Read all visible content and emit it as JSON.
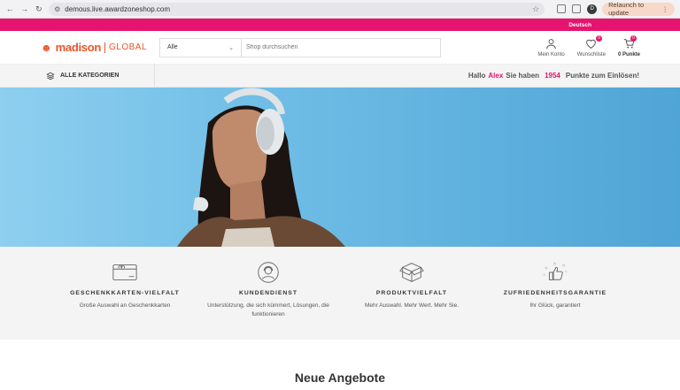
{
  "browser": {
    "url": "demous.live.awardzoneshop.com",
    "relaunch_label": "Relaunch to update",
    "profile_initial": "D"
  },
  "language": "Deutsch",
  "logo": {
    "brand": "madison",
    "global": "GLOBAL"
  },
  "search": {
    "category": "Alle",
    "placeholder": "Shop durchsuchen"
  },
  "header": {
    "account_label": "Mein Konto",
    "wishlist_label": "Wunschliste",
    "wishlist_count": "0",
    "cart_label": "0 Punkte",
    "cart_count": "0"
  },
  "categories": {
    "all_label": "ALLE KATEGORIEN"
  },
  "greeting": {
    "hello": "Hallo",
    "name": "Alex",
    "have": "Sie haben",
    "points": "1954",
    "rest": "Punkte zum Einlösen!"
  },
  "features": [
    {
      "title": "GESCHENKKARTEN-VIELFALT",
      "desc": "Große Auswahl an Geschenkkarten"
    },
    {
      "title": "KUNDENDIENST",
      "desc": "Unterstützung, die sich kümmert, Lösungen, die funktionieren"
    },
    {
      "title": "PRODUKTVIELFALT",
      "desc": "Mehr Auswahl. Mehr Wert. Mehr Sie."
    },
    {
      "title": "ZUFRIEDENHEITSGARANTIE",
      "desc": "Ihr Glück, garantiert"
    }
  ],
  "sections": {
    "new_offers": "Neue Angebote"
  },
  "colors": {
    "accent": "#e6146e",
    "brand": "#e8552b",
    "hero_sky": "#6fbde6"
  }
}
